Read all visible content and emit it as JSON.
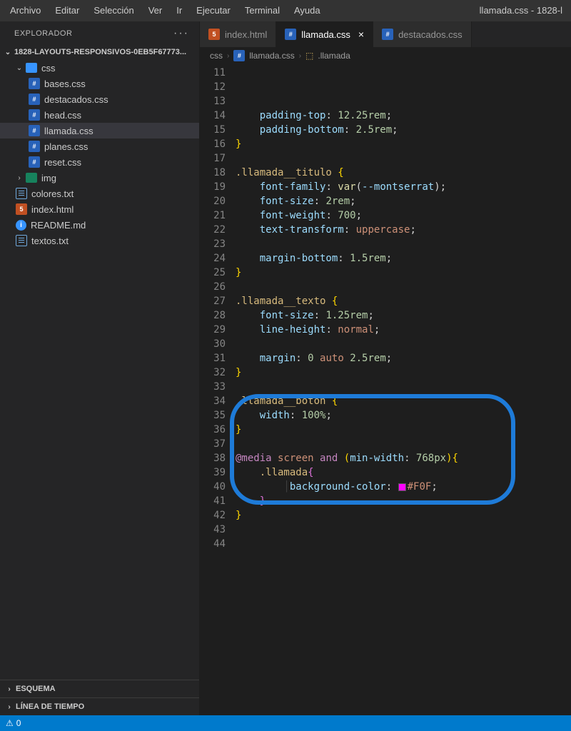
{
  "menubar": {
    "items": [
      "Archivo",
      "Editar",
      "Selección",
      "Ver",
      "Ir",
      "Ejecutar",
      "Terminal",
      "Ayuda"
    ],
    "window_title": "llamada.css - 1828-l"
  },
  "explorer": {
    "title": "EXPLORADOR",
    "project": "1828-LAYOUTS-RESPONSIVOS-0EB5F67773...",
    "tree": {
      "css_folder": "css",
      "files": [
        {
          "name": "bases.css",
          "type": "css"
        },
        {
          "name": "destacados.css",
          "type": "css"
        },
        {
          "name": "head.css",
          "type": "css"
        },
        {
          "name": "llamada.css",
          "type": "css",
          "active": true
        },
        {
          "name": "planes.css",
          "type": "css"
        },
        {
          "name": "reset.css",
          "type": "css"
        }
      ],
      "img_folder": "img",
      "root_files": [
        {
          "name": "colores.txt",
          "type": "txt"
        },
        {
          "name": "index.html",
          "type": "html"
        },
        {
          "name": "README.md",
          "type": "info"
        },
        {
          "name": "textos.txt",
          "type": "txt"
        }
      ]
    },
    "sections": {
      "esquema": "ESQUEMA",
      "timeline": "LÍNEA DE TIEMPO"
    }
  },
  "tabs": [
    {
      "label": "index.html",
      "type": "html"
    },
    {
      "label": "llamada.css",
      "type": "css",
      "active": true
    },
    {
      "label": "destacados.css",
      "type": "css"
    }
  ],
  "breadcrumbs": [
    "css",
    "llamada.css",
    ".llamada"
  ],
  "code": {
    "first_line": 11,
    "lines": [
      {
        "html": "    <span class='c-prop'>padding-top</span><span class='c-punc'>: </span><span class='c-num'>12.25rem</span><span class='c-punc'>;</span>"
      },
      {
        "html": "    <span class='c-prop'>padding-bottom</span><span class='c-punc'>: </span><span class='c-num'>2.5rem</span><span class='c-punc'>;</span>"
      },
      {
        "html": "<span class='c-br'>}</span>"
      },
      {
        "html": ""
      },
      {
        "html": "<span class='c-sel'>.llamada__titulo</span> <span class='c-br'>{</span>"
      },
      {
        "html": "    <span class='c-prop'>font-family</span><span class='c-punc'>: </span><span class='c-fn'>var</span><span class='c-punc'>(</span><span class='c-var'>--montserrat</span><span class='c-punc'>);</span>"
      },
      {
        "html": "    <span class='c-prop'>font-size</span><span class='c-punc'>: </span><span class='c-num'>2rem</span><span class='c-punc'>;</span>"
      },
      {
        "html": "    <span class='c-prop'>font-weight</span><span class='c-punc'>: </span><span class='c-num'>700</span><span class='c-punc'>;</span>"
      },
      {
        "html": "    <span class='c-prop'>text-transform</span><span class='c-punc'>: </span><span class='c-val'>uppercase</span><span class='c-punc'>;</span>"
      },
      {
        "html": ""
      },
      {
        "html": "    <span class='c-prop'>margin-bottom</span><span class='c-punc'>: </span><span class='c-num'>1.5rem</span><span class='c-punc'>;</span>"
      },
      {
        "html": "<span class='c-br'>}</span>"
      },
      {
        "html": ""
      },
      {
        "html": "<span class='c-sel'>.llamada__texto</span> <span class='c-br'>{</span>"
      },
      {
        "html": "    <span class='c-prop'>font-size</span><span class='c-punc'>: </span><span class='c-num'>1.25rem</span><span class='c-punc'>;</span>"
      },
      {
        "html": "    <span class='c-prop'>line-height</span><span class='c-punc'>: </span><span class='c-val'>normal</span><span class='c-punc'>;</span>"
      },
      {
        "html": ""
      },
      {
        "html": "    <span class='c-prop'>margin</span><span class='c-punc'>: </span><span class='c-num'>0</span> <span class='c-val'>auto</span> <span class='c-num'>2.5rem</span><span class='c-punc'>;</span>"
      },
      {
        "html": "<span class='c-br'>}</span>"
      },
      {
        "html": ""
      },
      {
        "html": "<span class='c-sel'>.llamada__boton</span> <span class='c-br'>{</span>"
      },
      {
        "html": "    <span class='c-prop'>width</span><span class='c-punc'>: </span><span class='c-num'>100%</span><span class='c-punc'>;</span>"
      },
      {
        "html": "<span class='c-br'>}</span>"
      },
      {
        "html": ""
      },
      {
        "html": "<span class='c-kw'>@media</span> <span class='c-val'>screen</span> <span class='c-kw'>and</span> <span class='c-br'>(</span><span class='c-prop'>min-width</span><span class='c-punc'>: </span><span class='c-num'>768px</span><span class='c-br'>){</span>"
      },
      {
        "html": "    <span class='c-sel'>.llamada</span><span class='c-br2'>{</span>"
      },
      {
        "html": "        <span class='indent-guide'>│</span><span class='c-prop'>background-color</span><span class='c-punc'>: </span><span class='swatch'></span><span class='c-val'>#F0F</span><span class='c-punc'>;</span>"
      },
      {
        "html": "    <span class='c-br2'>}</span>"
      },
      {
        "html": "<span class='c-br'>}</span>"
      },
      {
        "html": ""
      },
      {
        "html": ""
      },
      {
        "html": ""
      },
      {
        "html": ""
      },
      {
        "html": ""
      }
    ]
  },
  "statusbar": {
    "warnings": "0"
  }
}
